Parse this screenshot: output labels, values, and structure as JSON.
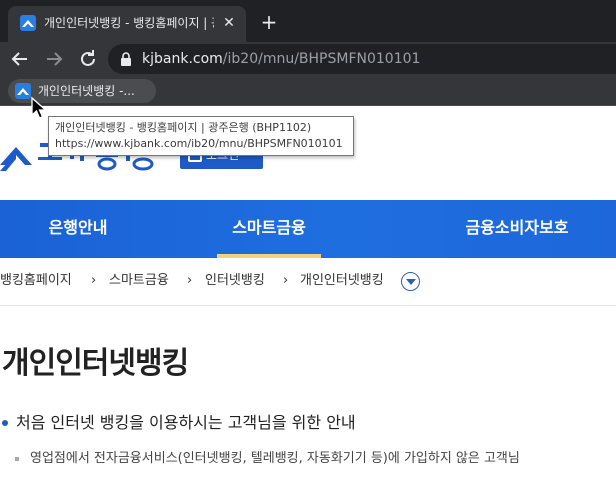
{
  "browser": {
    "tab": {
      "title": "개인인터넷뱅킹 - 뱅킹홈페이지 | 광",
      "close_icon": "close-icon"
    },
    "new_tab_label": "+",
    "url_host": "kjbank.com",
    "url_path": "/ib20/mnu/BHPSMFN010101",
    "bookmark_label": "개인인터넷뱅킹 -...",
    "tooltip": {
      "line1": "개인인터넷뱅킹 - 뱅킹홈페이지 | 광주은행 (BHP1102)",
      "line2": "https://www.kjbank.com/ib20/mnu/BHPSMFN010101"
    }
  },
  "page": {
    "login_label": "로그인",
    "nav": [
      {
        "label": "은행안내"
      },
      {
        "label": "스마트금융",
        "active": true
      },
      {
        "label": "금융소비자보호"
      }
    ],
    "breadcrumb": [
      "뱅킹홈페이지",
      "스마트금융",
      "인터넷뱅킹",
      "개인인터넷뱅킹"
    ],
    "title": "개인인터넷뱅킹",
    "section_heading": "처음 인터넷 뱅킹을 이용하시는 고객님을 위한 안내",
    "section_text": "영업점에서 전자금융서비스(인터넷뱅킹, 텔레뱅킹, 자동화기기 등)에 가입하지 않은 고객님"
  },
  "colors": {
    "brand_blue": "#1e5bc6",
    "nav_active_underline": "#f2d27a",
    "chrome_dark": "#202124"
  }
}
